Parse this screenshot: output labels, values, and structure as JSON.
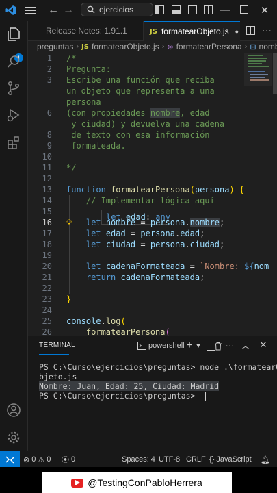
{
  "titlebar": {
    "search_text": "ejercicios",
    "icons": [
      "vscode-logo-icon",
      "menu-icon",
      "back-icon",
      "forward-icon",
      "search-icon",
      "layout-icons"
    ]
  },
  "tabs": [
    {
      "label": "Release Notes: 1.91.1",
      "active": false
    },
    {
      "label": "formatearObjeto.js",
      "active": true,
      "lang": "JS"
    }
  ],
  "breadcrumb": [
    "preguntas",
    "formatearObjeto.js",
    "formatearPersona",
    "nombre"
  ],
  "activity": {
    "badge": "1"
  },
  "editor": {
    "current_line": "16",
    "lines": [
      {
        "n": "1",
        "parts": [
          [
            "c-cm",
            "/*"
          ]
        ]
      },
      {
        "n": "2",
        "parts": [
          [
            "c-cm",
            "Pregunta:"
          ]
        ]
      },
      {
        "n": "3",
        "parts": [
          [
            "c-cm",
            "Escribe una función que reciba"
          ]
        ]
      },
      {
        "n": "",
        "parts": [
          [
            "c-cm",
            "un objeto que representa a una"
          ]
        ]
      },
      {
        "n": "",
        "parts": [
          [
            "c-cm",
            "persona"
          ]
        ]
      },
      {
        "n": "6",
        "parts": [
          [
            "c-cm",
            "(con propiedades "
          ],
          [
            "c-cm hl",
            "nombre"
          ],
          [
            "c-cm",
            ", edad"
          ]
        ]
      },
      {
        "n": "",
        "parts": [
          [
            "c-cm",
            " y ciudad) y devuelva una cadena"
          ]
        ]
      },
      {
        "n": "8",
        "parts": [
          [
            "c-cm",
            " de texto con esa información"
          ]
        ]
      },
      {
        "n": "9",
        "parts": [
          [
            "c-cm",
            " formateada."
          ]
        ]
      },
      {
        "n": "10",
        "parts": []
      },
      {
        "n": "11",
        "parts": [
          [
            "c-cm",
            "*/"
          ]
        ]
      },
      {
        "n": "12",
        "parts": []
      },
      {
        "n": "13",
        "parts": [
          [
            "c-kw",
            "function "
          ],
          [
            "c-fn",
            "formatearPersona"
          ],
          [
            "c-b",
            "("
          ],
          [
            "c-var",
            "persona"
          ],
          [
            "c-b",
            ")"
          ],
          [
            "c-p",
            " "
          ],
          [
            "c-b",
            "{"
          ]
        ]
      },
      {
        "n": "14",
        "parts": [
          [
            "c-p",
            "    "
          ],
          [
            "c-cm",
            "// Implementar lógica aquí"
          ]
        ]
      },
      {
        "n": "15",
        "parts": []
      },
      {
        "n": "16",
        "parts": [
          [
            "c-p",
            "    "
          ],
          [
            "c-kw",
            "let "
          ],
          [
            "c-var",
            "nombre"
          ],
          [
            "c-p",
            " = "
          ],
          [
            "c-var",
            "persona"
          ],
          [
            "c-p",
            "."
          ],
          [
            "c-var hl",
            "nombre"
          ],
          [
            "c-p",
            ";"
          ]
        ]
      },
      {
        "n": "17",
        "parts": [
          [
            "c-p",
            "    "
          ],
          [
            "c-kw",
            "let "
          ],
          [
            "c-var",
            "edad"
          ],
          [
            "c-p",
            " = "
          ],
          [
            "c-var",
            "persona"
          ],
          [
            "c-p",
            "."
          ],
          [
            "c-var",
            "edad"
          ],
          [
            "c-p",
            ";"
          ]
        ]
      },
      {
        "n": "18",
        "parts": [
          [
            "c-p",
            "    "
          ],
          [
            "c-kw",
            "let "
          ],
          [
            "c-var",
            "ciudad"
          ],
          [
            "c-p",
            " = "
          ],
          [
            "c-var",
            "persona"
          ],
          [
            "c-p",
            "."
          ],
          [
            "c-var",
            "ciudad"
          ],
          [
            "c-p",
            ";"
          ]
        ]
      },
      {
        "n": "19",
        "parts": []
      },
      {
        "n": "20",
        "parts": [
          [
            "c-p",
            "    "
          ],
          [
            "c-kw",
            "let "
          ],
          [
            "c-var",
            "cadenaFormateada"
          ],
          [
            "c-p",
            " = "
          ],
          [
            "c-str",
            "`Nombre: "
          ],
          [
            "c-kw",
            "${"
          ],
          [
            "c-var",
            "nom"
          ]
        ]
      },
      {
        "n": "21",
        "parts": [
          [
            "c-p",
            "    "
          ],
          [
            "c-kw",
            "return "
          ],
          [
            "c-var",
            "cadenaFormateada"
          ],
          [
            "c-p",
            ";"
          ]
        ]
      },
      {
        "n": "22",
        "parts": []
      },
      {
        "n": "23",
        "parts": [
          [
            "c-b",
            "}"
          ]
        ]
      },
      {
        "n": "24",
        "parts": []
      },
      {
        "n": "25",
        "parts": [
          [
            "c-var",
            "console"
          ],
          [
            "c-p",
            "."
          ],
          [
            "c-fn",
            "log"
          ],
          [
            "c-b",
            "("
          ]
        ]
      },
      {
        "n": "26",
        "parts": [
          [
            "c-p",
            "    "
          ],
          [
            "c-fn",
            "formatearPersona"
          ],
          [
            "c-b2",
            "("
          ]
        ]
      }
    ],
    "hover": {
      "keyword": "let",
      "name": "edad",
      "type": "any"
    }
  },
  "panel": {
    "tab": "TERMINAL",
    "shell": "powershell",
    "lines": [
      {
        "text": "PS C:\\Curso\\ejercicios\\preguntas> node .\\formatearO",
        "sel": false
      },
      {
        "text": "bjeto.js",
        "sel": false
      },
      {
        "text": "Nombre: Juan, Edad: 25, Ciudad: Madrid",
        "sel": true
      },
      {
        "text": "PS C:\\Curso\\ejercicios\\preguntas> ",
        "sel": false,
        "cursor": true
      }
    ]
  },
  "status": {
    "errors": "0",
    "warnings": "0",
    "ports": "0",
    "spaces": "Spaces: 4",
    "encoding": "UTF-8",
    "eol": "CRLF",
    "language": "JavaScript"
  },
  "watermark": "@TestingConPabloHerrera"
}
